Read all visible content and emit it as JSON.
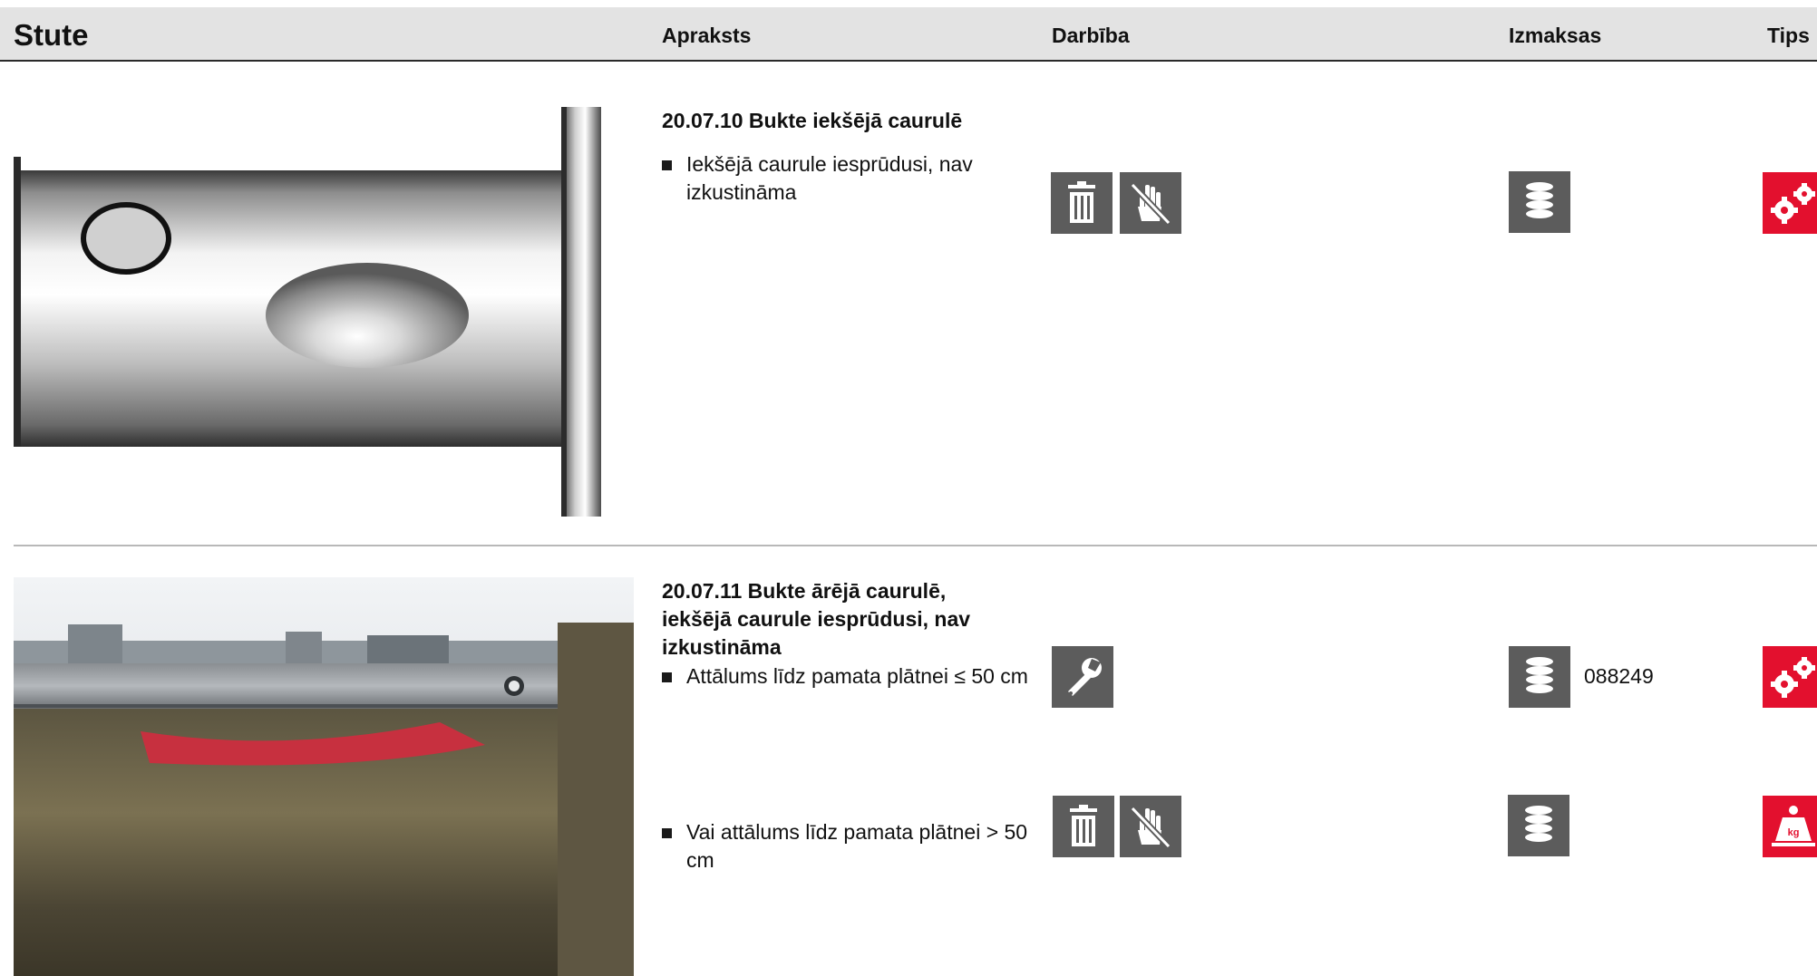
{
  "header": {
    "title": "Stute",
    "col_description": "Apraksts",
    "col_action": "Darbība",
    "col_cost": "Izmaksas",
    "col_tips": "Tips"
  },
  "colors": {
    "header_bg": "#e3e3e3",
    "icon_bg": "#5c5c5c",
    "tip_bg": "#e3102e"
  },
  "entries": [
    {
      "title": "20.07.10 Bukte iekšējā caurulē",
      "rows": [
        {
          "text": "Iekšējā caurule iesprūdusi, nav izkustināma",
          "actions": [
            "trash-icon",
            "no-touch-hand-icon"
          ],
          "cost_icon": "coin-stack-icon",
          "cost_code": "",
          "tip_icon": "gears-icon"
        }
      ]
    },
    {
      "title": "20.07.11 Bukte ārējā caurulē, iekšējā caurule iesprūdusi, nav izkustināma",
      "rows": [
        {
          "text": "Attālums līdz pamata plātnei ≤ 50 cm",
          "actions": [
            "wrench-icon"
          ],
          "cost_icon": "coin-stack-icon",
          "cost_code": "088249",
          "tip_icon": "gears-icon"
        },
        {
          "text": "Vai attālums līdz pamata plātnei > 50 cm",
          "actions": [
            "trash-icon",
            "no-touch-hand-icon"
          ],
          "cost_icon": "coin-stack-icon",
          "cost_code": "",
          "tip_icon": "weight-kg-icon"
        }
      ]
    }
  ]
}
